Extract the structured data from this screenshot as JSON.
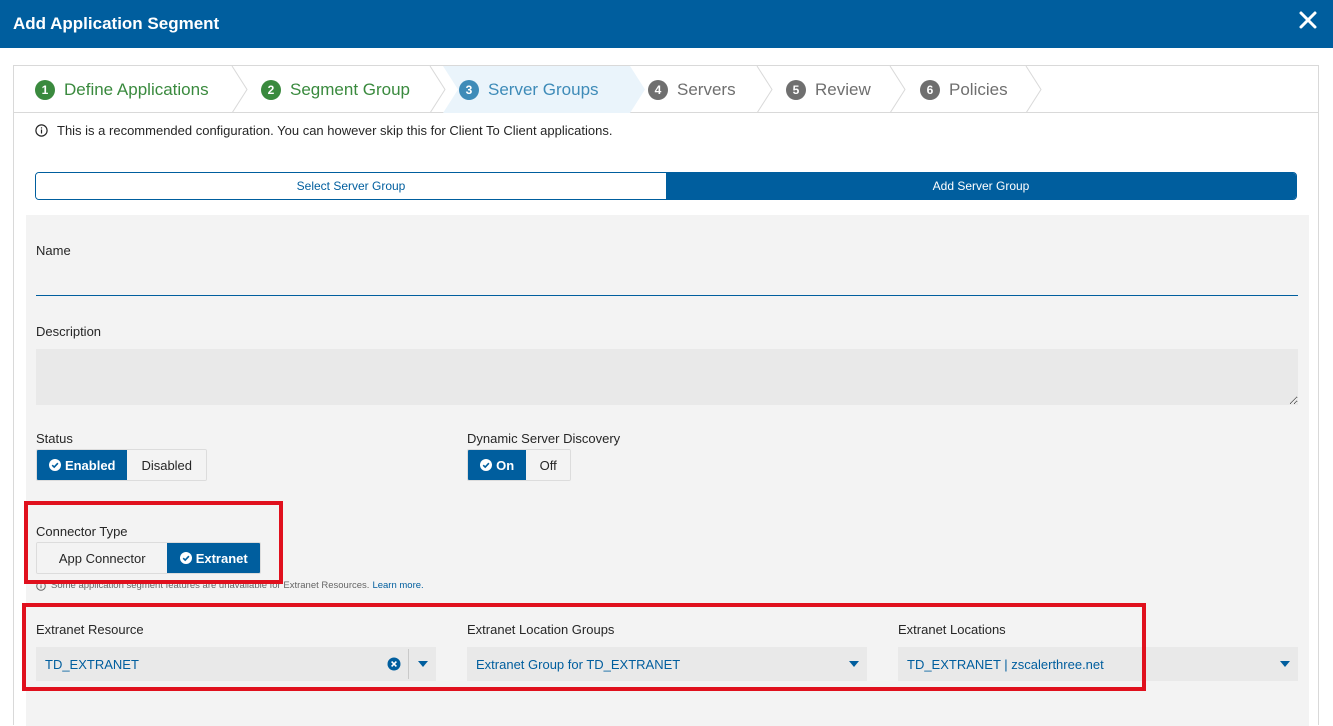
{
  "dialog": {
    "title": "Add Application Segment",
    "close_icon": "close-icon"
  },
  "steps": [
    {
      "num": "1",
      "label": "Define Applications",
      "state": "done"
    },
    {
      "num": "2",
      "label": "Segment Group",
      "state": "done"
    },
    {
      "num": "3",
      "label": "Server Groups",
      "state": "active"
    },
    {
      "num": "4",
      "label": "Servers",
      "state": "todo"
    },
    {
      "num": "5",
      "label": "Review",
      "state": "todo"
    },
    {
      "num": "6",
      "label": "Policies",
      "state": "todo"
    }
  ],
  "info_text": "This is a recommended configuration. You can however skip this for Client To Client applications.",
  "mode_tabs": {
    "select": "Select Server Group",
    "add": "Add Server Group",
    "selected": "add"
  },
  "form": {
    "name_label": "Name",
    "name_value": "",
    "description_label": "Description",
    "description_value": "",
    "status": {
      "label": "Status",
      "enabled": "Enabled",
      "disabled": "Disabled",
      "selected": "Enabled"
    },
    "dynamic_discovery": {
      "label": "Dynamic Server Discovery",
      "on": "On",
      "off": "Off",
      "selected": "On"
    },
    "connector_type": {
      "label": "Connector Type",
      "app_connector": "App Connector",
      "extranet": "Extranet",
      "selected": "Extranet"
    },
    "extranet_note": {
      "text": "Some application segment features are unavailable for Extranet Resources.",
      "link": "Learn more."
    },
    "extranet_resource": {
      "label": "Extranet Resource",
      "value": "TD_EXTRANET"
    },
    "extranet_location_groups": {
      "label": "Extranet Location Groups",
      "value": "Extranet Group for TD_EXTRANET"
    },
    "extranet_locations": {
      "label": "Extranet Locations",
      "value": "TD_EXTRANET | zscalerthree.net"
    }
  },
  "colors": {
    "brand": "#005e9e",
    "done_step": "#3a8a3e",
    "active_step": "#3e8bb8",
    "highlight": "#e0101d"
  }
}
